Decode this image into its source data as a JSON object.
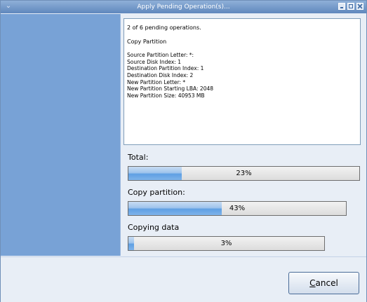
{
  "window": {
    "title": "Apply Pending Operation(s)..."
  },
  "log": {
    "heading": "2 of 6 pending operations.",
    "operation": "Copy Partition",
    "lines": [
      "Source Partition Letter: *:",
      "Source Disk Index: 1",
      "Destination Partition Index: 1",
      "Destination Disk Index: 2",
      "New Partition Letter: *",
      "New Partition Starting LBA: 2048",
      "New Partition Size: 40953 MB"
    ]
  },
  "progress": {
    "total": {
      "label": "Total:",
      "percent_text": "23%",
      "value": 0.23
    },
    "copy_partition": {
      "label": "Copy partition:",
      "percent_text": "43%",
      "value": 0.43
    },
    "copying_data": {
      "label": "Copying data",
      "percent_text": "3%",
      "value": 0.03
    }
  },
  "buttons": {
    "cancel": {
      "mnemonic": "C",
      "rest": "ancel"
    }
  },
  "colors": {
    "side_panel": "#78a2d6",
    "progress_fill": "#5f9fe3"
  },
  "icons": {
    "window_menu": "chevron-down-icon",
    "minimize": "minimize-icon",
    "maximize": "maximize-icon",
    "close": "close-icon"
  }
}
